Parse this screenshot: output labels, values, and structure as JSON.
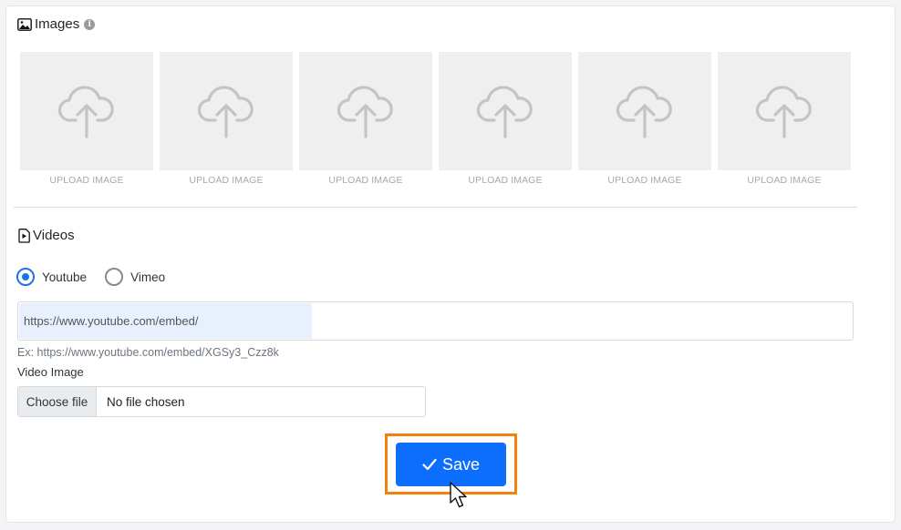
{
  "images": {
    "title": "Images",
    "icon": "image-icon",
    "info_icon": "info-icon",
    "info_glyph": "i",
    "tiles": [
      {
        "label": "UPLOAD IMAGE",
        "icon": "cloud-upload-icon"
      },
      {
        "label": "UPLOAD IMAGE",
        "icon": "cloud-upload-icon"
      },
      {
        "label": "UPLOAD IMAGE",
        "icon": "cloud-upload-icon"
      },
      {
        "label": "UPLOAD IMAGE",
        "icon": "cloud-upload-icon"
      },
      {
        "label": "UPLOAD IMAGE",
        "icon": "cloud-upload-icon"
      },
      {
        "label": "UPLOAD IMAGE",
        "icon": "cloud-upload-icon"
      }
    ]
  },
  "videos": {
    "title": "Videos",
    "icon": "file-play-icon",
    "providers": [
      {
        "label": "Youtube",
        "checked": true
      },
      {
        "label": "Vimeo",
        "checked": false
      }
    ],
    "url_value": "https://www.youtube.com/embed/",
    "url_hint": "Ex: https://www.youtube.com/embed/XGSy3_Czz8k",
    "video_image_label": "Video Image",
    "file_button_label": "Choose file",
    "file_status": "No file chosen"
  },
  "save": {
    "label": "Save",
    "icon": "check-icon"
  },
  "colors": {
    "accent": "#0d6efd",
    "radio_checked": "#1a73e8",
    "highlight": "#f5800a",
    "tile_bg": "#efefef"
  }
}
